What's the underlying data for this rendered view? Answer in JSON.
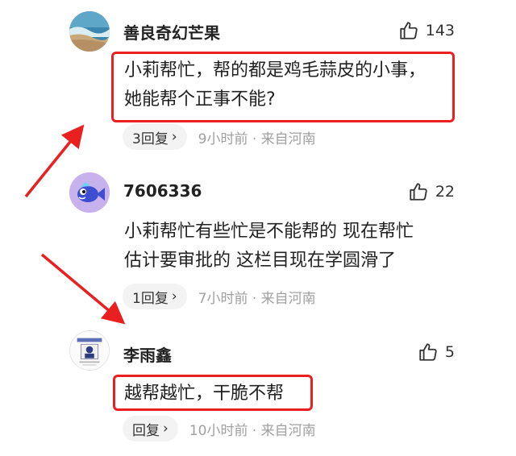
{
  "comments": [
    {
      "username": "善良奇幻芒果",
      "likes": "143",
      "lines": [
        "小莉帮忙，帮的都是鸡毛蒜皮的小事，",
        "她能帮个正事不能?"
      ],
      "reply_label": "3回复",
      "time_location": "9小时前 · 来自河南"
    },
    {
      "username": "7606336",
      "likes": "22",
      "lines": [
        "小莉帮忙有些忙是不能帮的 现在帮忙",
        "估计要审批的 这栏目现在学圆滑了"
      ],
      "reply_label": "1回复",
      "time_location": "7小时前 · 来自河南"
    },
    {
      "username": "李雨鑫",
      "likes": "5",
      "lines": [
        "越帮越忙，干脆不帮"
      ],
      "reply_label": "回复",
      "time_location": "10小时前 · 来自河南"
    }
  ],
  "colors": {
    "highlight": "#ea1f1f",
    "meta_text": "#a0a0a0",
    "pill_bg": "#f3f3f3"
  },
  "icons": {
    "like": "thumbs-up-icon",
    "reply_chevron": "chevron-right-icon"
  }
}
